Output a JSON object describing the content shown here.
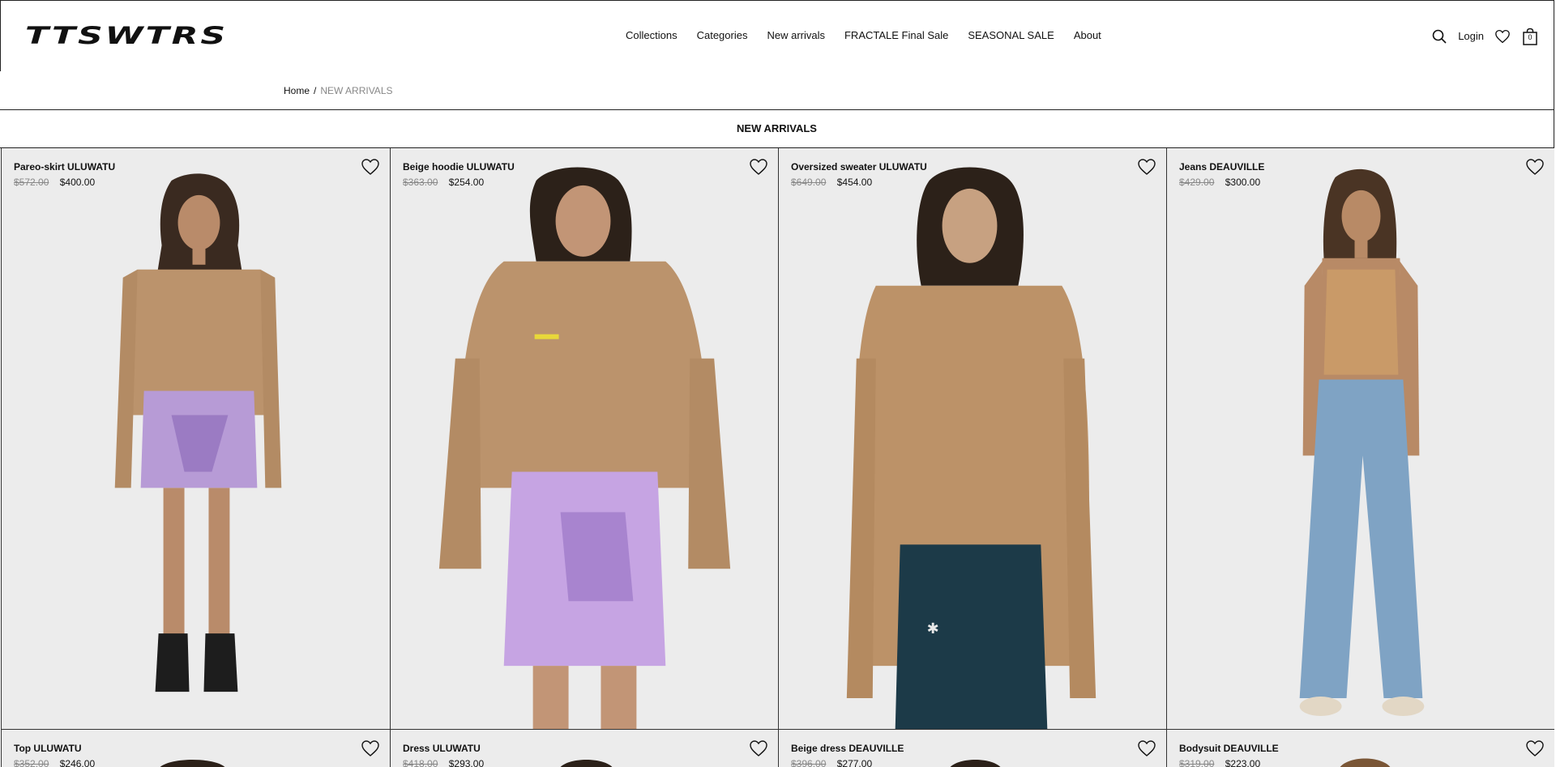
{
  "header": {
    "logo_text": "TTSWTRS",
    "nav": [
      "Collections",
      "Categories",
      "New arrivals",
      "FRACTALE Final Sale",
      "SEASONAL SALE",
      "About"
    ],
    "login_label": "Login",
    "cart_count": "0",
    "icons": [
      "search-icon",
      "heart-icon",
      "bag-icon"
    ]
  },
  "breadcrumb": {
    "home": "Home",
    "separator": "/",
    "current": "NEW ARRIVALS"
  },
  "page": {
    "title": "NEW ARRIVALS"
  },
  "products": [
    {
      "name": "Pareo-skirt ULUWATU",
      "old_price": "$572.00",
      "price": "$400.00"
    },
    {
      "name": "Beige hoodie ULUWATU",
      "old_price": "$363.00",
      "price": "$254.00"
    },
    {
      "name": "Oversized sweater ULUWATU",
      "old_price": "$649.00",
      "price": "$454.00"
    },
    {
      "name": "Jeans DEAUVILLE",
      "old_price": "$429.00",
      "price": "$300.00"
    },
    {
      "name": "Top ULUWATU",
      "old_price": "$352.00",
      "price": "$246.00"
    },
    {
      "name": "Dress ULUWATU",
      "old_price": "$418.00",
      "price": "$293.00"
    },
    {
      "name": "Beige dress DEAUVILLE",
      "old_price": "$396.00",
      "price": "$277.00"
    },
    {
      "name": "Bodysuit DEAUVILLE",
      "old_price": "$319.00",
      "price": "$223.00"
    }
  ],
  "colors": {
    "background": "#ffffff",
    "photo_background": "#ececec",
    "border": "#222222",
    "text": "#111111",
    "muted_text": "#888888"
  }
}
